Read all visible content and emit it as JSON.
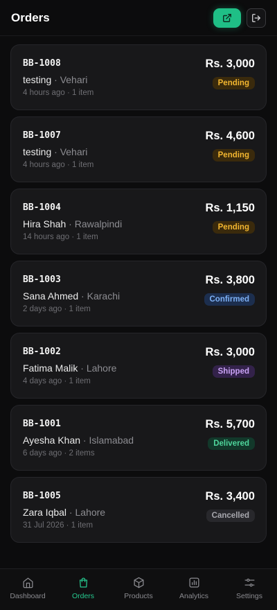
{
  "header": {
    "title": "Orders",
    "export_icon": "external-link-icon",
    "logout_icon": "logout-icon",
    "accent": "#1fbf86"
  },
  "orders": [
    {
      "id": "BB-1008",
      "customer": "testing",
      "city": "Vehari",
      "time": "4 hours ago",
      "items": "1 item",
      "amount": "Rs. 3,000",
      "status": "Pending"
    },
    {
      "id": "BB-1007",
      "customer": "testing",
      "city": "Vehari",
      "time": "4 hours ago",
      "items": "1 item",
      "amount": "Rs. 4,600",
      "status": "Pending"
    },
    {
      "id": "BB-1004",
      "customer": "Hira Shah",
      "city": "Rawalpindi",
      "time": "14 hours ago",
      "items": "1 item",
      "amount": "Rs. 1,150",
      "status": "Pending"
    },
    {
      "id": "BB-1003",
      "customer": "Sana Ahmed",
      "city": "Karachi",
      "time": "2 days ago",
      "items": "1 item",
      "amount": "Rs. 3,800",
      "status": "Confirmed"
    },
    {
      "id": "BB-1002",
      "customer": "Fatima Malik",
      "city": "Lahore",
      "time": "4 days ago",
      "items": "1 item",
      "amount": "Rs. 3,000",
      "status": "Shipped"
    },
    {
      "id": "BB-1001",
      "customer": "Ayesha Khan",
      "city": "Islamabad",
      "time": "6 days ago",
      "items": "2 items",
      "amount": "Rs. 5,700",
      "status": "Delivered"
    },
    {
      "id": "BB-1005",
      "customer": "Zara Iqbal",
      "city": "Lahore",
      "time": "31 Jul 2026",
      "items": "1 item",
      "amount": "Rs. 3,400",
      "status": "Cancelled"
    }
  ],
  "status_colors": {
    "Pending": "#f2b630",
    "Confirmed": "#7db0f5",
    "Shipped": "#c9a2f5",
    "Delivered": "#4fd69c",
    "Cancelled": "#a7a7ad"
  },
  "tabs": [
    {
      "label": "Dashboard",
      "icon": "home-icon",
      "active": false
    },
    {
      "label": "Orders",
      "icon": "shopping-bag-icon",
      "active": true
    },
    {
      "label": "Products",
      "icon": "box-icon",
      "active": false
    },
    {
      "label": "Analytics",
      "icon": "bar-chart-icon",
      "active": false
    },
    {
      "label": "Settings",
      "icon": "sliders-icon",
      "active": false
    }
  ]
}
